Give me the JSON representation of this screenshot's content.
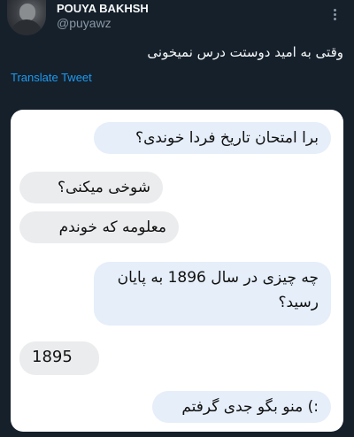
{
  "tweet": {
    "display_name": "POUYA BAKHSH",
    "handle": "@puyawz",
    "text": "وقتی به امید دوستت درس نمیخونی",
    "translate_label": "Translate Tweet"
  },
  "chat": {
    "messages": [
      {
        "direction": "outgoing",
        "text": "برا امتحان تاریخ فردا خوندی؟"
      },
      {
        "direction": "incoming",
        "text": "شوخی میکنی؟"
      },
      {
        "direction": "incoming",
        "text": "معلومه که خوندم"
      },
      {
        "direction": "outgoing",
        "text": "چه چیزی در سال 1896 به پایان رسید؟"
      },
      {
        "direction": "incoming",
        "text": "1895"
      },
      {
        "direction": "outgoing",
        "text": ":) منو بگو جدی گرفتم"
      }
    ]
  },
  "colors": {
    "background": "#15202b",
    "link": "#1d9bf0",
    "outgoing_bubble": "#e5eef9",
    "incoming_bubble": "#ebecee"
  },
  "icons": {
    "more": "more-vertical-icon"
  }
}
